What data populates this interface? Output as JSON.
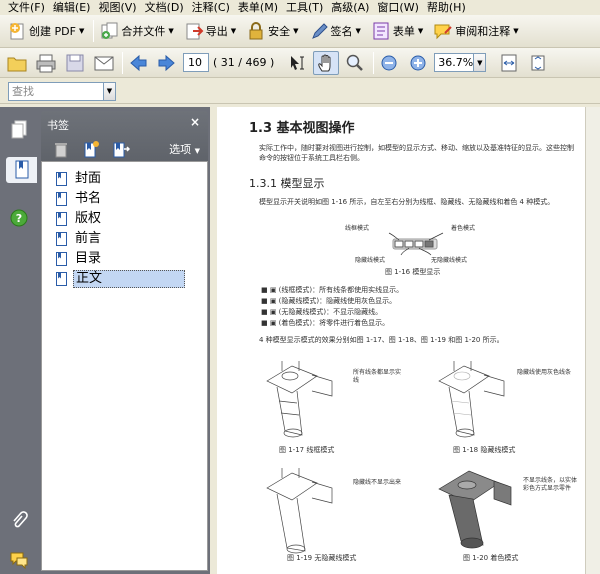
{
  "menu": [
    "文件(F)",
    "编辑(E)",
    "视图(V)",
    "文档(D)",
    "注释(C)",
    "表单(M)",
    "工具(T)",
    "高级(A)",
    "窗口(W)",
    "帮助(H)"
  ],
  "toolbar": {
    "create_pdf": "创建 PDF",
    "combine": "合并文件",
    "export": "导出",
    "secure": "安全",
    "sign": "签名",
    "forms": "表单",
    "review": "审阅和注释"
  },
  "nav": {
    "page_current": "10",
    "page_count": "( 31 / 469 )",
    "zoom": "36.7%"
  },
  "search": {
    "placeholder": "查找"
  },
  "bookmarks": {
    "title": "书签",
    "options": "选项",
    "items": [
      {
        "label": "封面"
      },
      {
        "label": "书名"
      },
      {
        "label": "版权"
      },
      {
        "label": "前言"
      },
      {
        "label": "目录"
      },
      {
        "label": "正文"
      }
    ]
  },
  "doc": {
    "section": "1.3   基本视图操作",
    "intro": "实际工作中，随时要对视图进行控制，如模型的显示方式、移动、缩放以及基准特征的显示。这些控制命令的按钮位于系统工具栏右侧。",
    "subsection": "1.3.1   模型显示",
    "para1": "模型显示开关说明如图 1-16 所示，自左至右分别为线框、隐藏线、无隐藏线和着色 4 种模式。",
    "fig16": {
      "labels": [
        "线框模式",
        "着色模式",
        "隐藏线模式",
        "无隐藏线模式"
      ],
      "caption": "图 1-16   模型显示"
    },
    "bullets": [
      "■ ▣ (线框模式)：所有线条都使用实线显示。",
      "■ ▣ (隐藏线模式)：隐藏线使用灰色显示。",
      "■ ▣ (无隐藏线模式)：不显示隐藏线。",
      "■ ▣ (着色模式)：将零件进行着色显示。"
    ],
    "para2": "4 种模型显示模式的效果分别如图 1-17、图 1-18、图 1-19 和图 1-20 所示。",
    "figs": [
      {
        "caption": "图 1-17   线框模式",
        "note": "所有线条都显示实线"
      },
      {
        "caption": "图 1-18   隐藏线模式",
        "note": "隐藏线使用灰色线条"
      },
      {
        "caption": "图 1-19   无隐藏线模式",
        "note": "隐藏线不显示出来"
      },
      {
        "caption": "图 1-20   着色模式",
        "note": "不显示线条，以实体彩色方式显示零件"
      }
    ]
  }
}
